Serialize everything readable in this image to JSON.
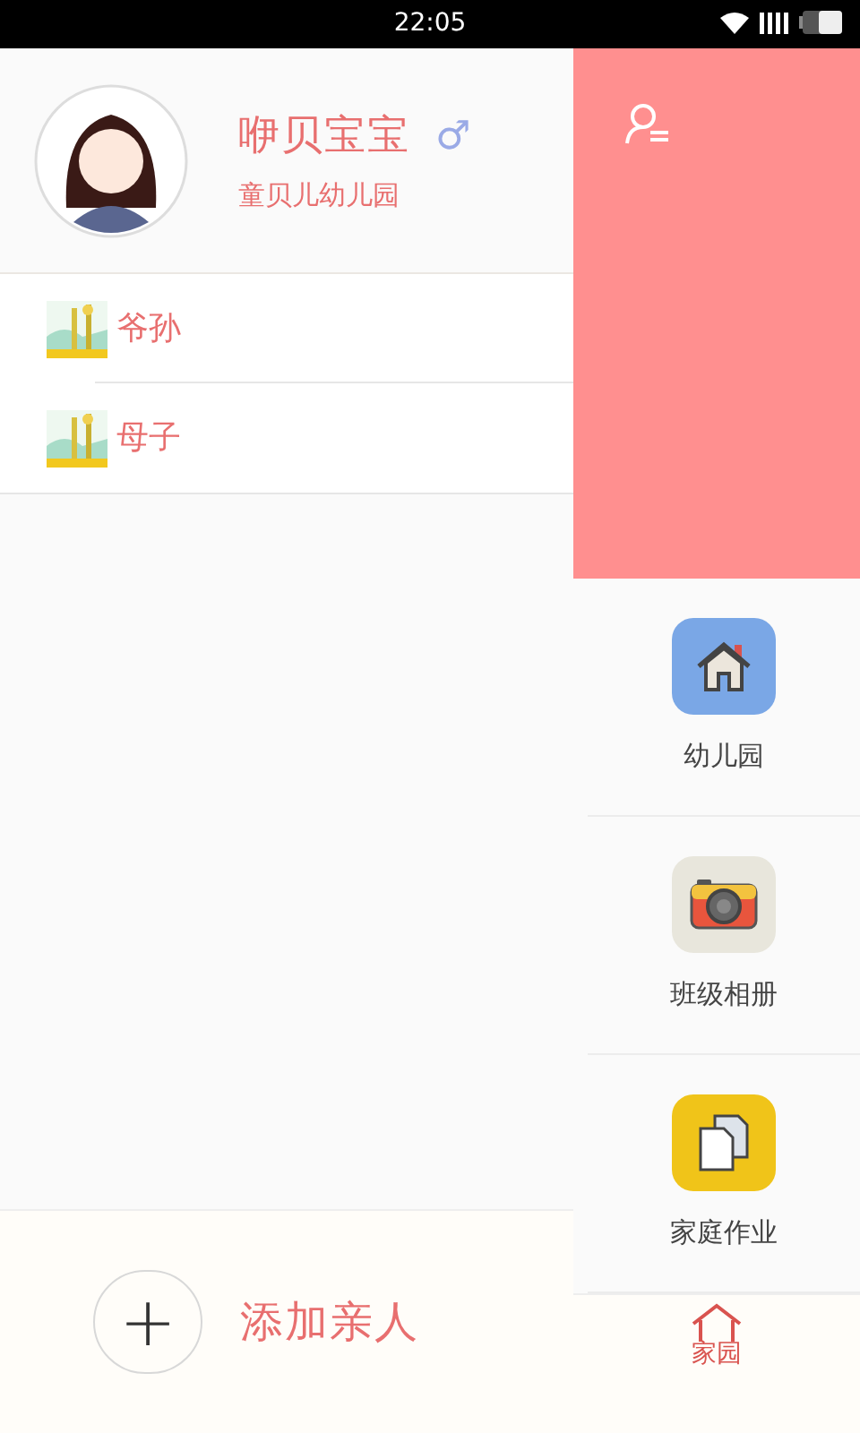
{
  "status_bar": {
    "time": "22:05"
  },
  "profile": {
    "name": "咿贝宝宝",
    "gender_symbol": "♂",
    "school": "童贝儿幼儿园"
  },
  "relatives": [
    {
      "label": "爷孙",
      "kind": "picture"
    },
    {
      "label": "母子",
      "kind": "picture"
    }
  ],
  "add_button": {
    "icon": "+",
    "label": "添加亲人"
  },
  "menu": [
    {
      "label": "幼儿园",
      "kind": "house"
    },
    {
      "label": "班级相册",
      "kind": "camera"
    },
    {
      "label": "家庭作业",
      "kind": "documents"
    },
    {
      "label": "家园",
      "kind": "home-outline"
    }
  ]
}
